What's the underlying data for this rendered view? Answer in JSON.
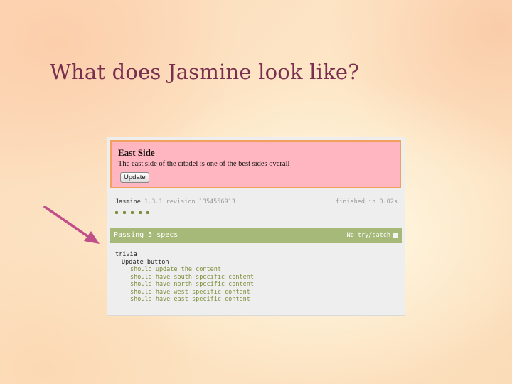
{
  "slide": {
    "title": "What does Jasmine look like?"
  },
  "colors": {
    "title": "#7a2f4f",
    "arrow": "#c14f8a",
    "fixture_bg": "#ffb6c1",
    "fixture_border": "#f2a05c",
    "pass_bar": "#a7b979",
    "spec_green": "#7d8f3c"
  },
  "fixture": {
    "heading": "East Side",
    "text": "The east side of the citadel is one of the best sides overall",
    "button_label": "Update"
  },
  "jasmine": {
    "banner_name": "Jasmine",
    "banner_version": "1.3.1 revision 1354556913",
    "finished": "finished in 0.02s",
    "passing": "Passing 5 specs",
    "trycatch_label": "No try/catch",
    "suite": "trivia",
    "subsuite": "Update button",
    "specs": [
      "should update the content",
      "should have south specific content",
      "should have north specific content",
      "should have west specific content",
      "should have east specific content"
    ]
  }
}
